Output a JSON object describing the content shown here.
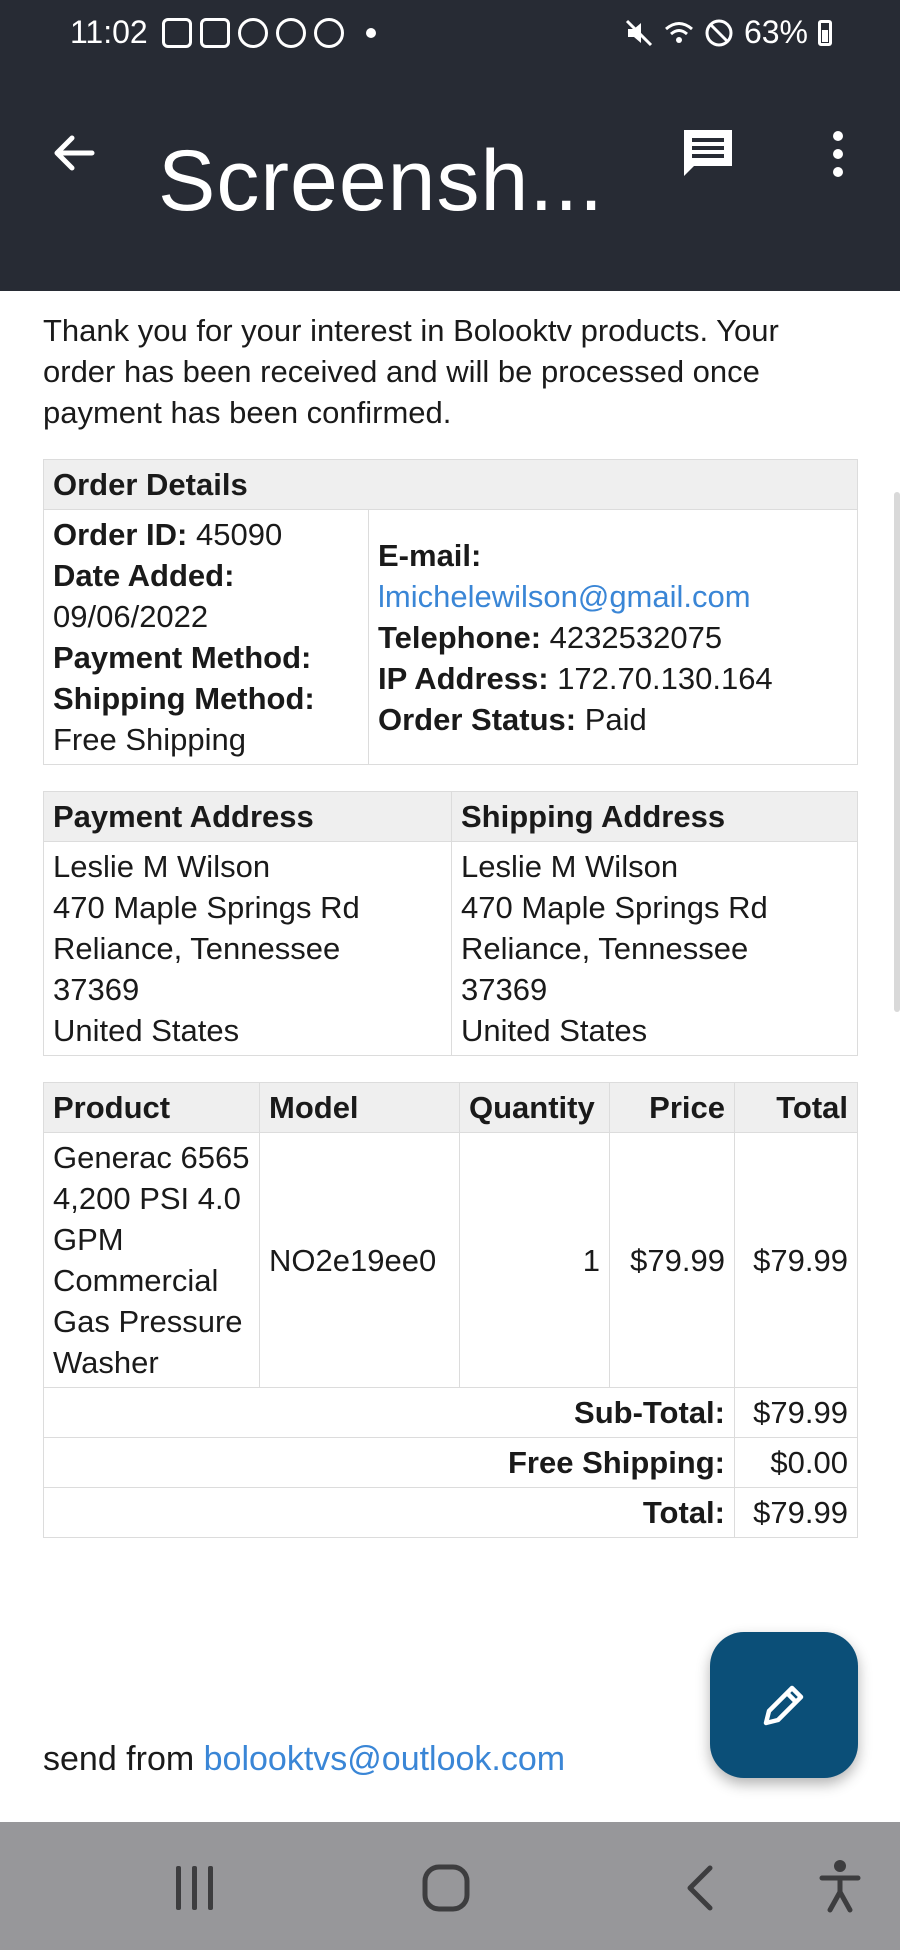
{
  "status_bar": {
    "time": "11:02",
    "battery": "63%"
  },
  "app_bar": {
    "title": "Screensh..."
  },
  "intro": {
    "text": "Thank you for your interest in Bolooktv products. Your order has been received and will be processed once payment has been confirmed."
  },
  "order_details": {
    "header": "Order Details",
    "order_id_label": "Order ID:",
    "order_id": "45090",
    "date_added_label": "Date Added:",
    "date_added": "09/06/2022",
    "payment_method_label": "Payment Method:",
    "shipping_method_label": "Shipping Method:",
    "shipping_method": "Free Shipping",
    "email_label": "E-mail:",
    "email": "lmichelewilson@gmail.com",
    "telephone_label": "Telephone:",
    "telephone": "4232532075",
    "ip_label": "IP Address:",
    "ip": "172.70.130.164",
    "status_label": "Order Status:",
    "status": "Paid"
  },
  "addresses": {
    "payment_header": "Payment Address",
    "shipping_header": "Shipping Address",
    "payment_lines": [
      "Leslie M Wilson",
      "470 Maple Springs Rd",
      "Reliance, Tennessee",
      "37369",
      "United States"
    ],
    "shipping_lines": [
      "Leslie M Wilson",
      "470 Maple Springs Rd",
      "Reliance, Tennessee",
      "37369",
      "United States"
    ]
  },
  "products": {
    "headers": {
      "product": "Product",
      "model": "Model",
      "quantity": "Quantity",
      "price": "Price",
      "total": "Total"
    },
    "row": {
      "product": "Generac 6565 4,200 PSI 4.0 GPM Commercial Gas Pressure Washer",
      "model": "NO2e19ee0",
      "quantity": "1",
      "price": "$79.99",
      "total": "$79.99"
    },
    "subtotal_label": "Sub-Total:",
    "subtotal": "$79.99",
    "shipping_label": "Free Shipping:",
    "shipping": "$0.00",
    "total_label": "Total:",
    "total": "$79.99"
  },
  "footer": {
    "send_from": "send from",
    "sender_email": "bolooktvs@outlook.com"
  },
  "icons": {
    "back": "arrow-left-icon",
    "comment": "comment-icon",
    "more": "more-vert-icon",
    "fab": "pencil-icon",
    "nav_recent": "recent-apps-icon",
    "nav_home": "home-icon",
    "nav_back": "nav-back-icon",
    "nav_accessibility": "accessibility-icon"
  },
  "colors": {
    "app_bar": "#272b34",
    "link": "#3a86d6",
    "fab": "#0b4f78",
    "nav_bar": "#97979a"
  }
}
